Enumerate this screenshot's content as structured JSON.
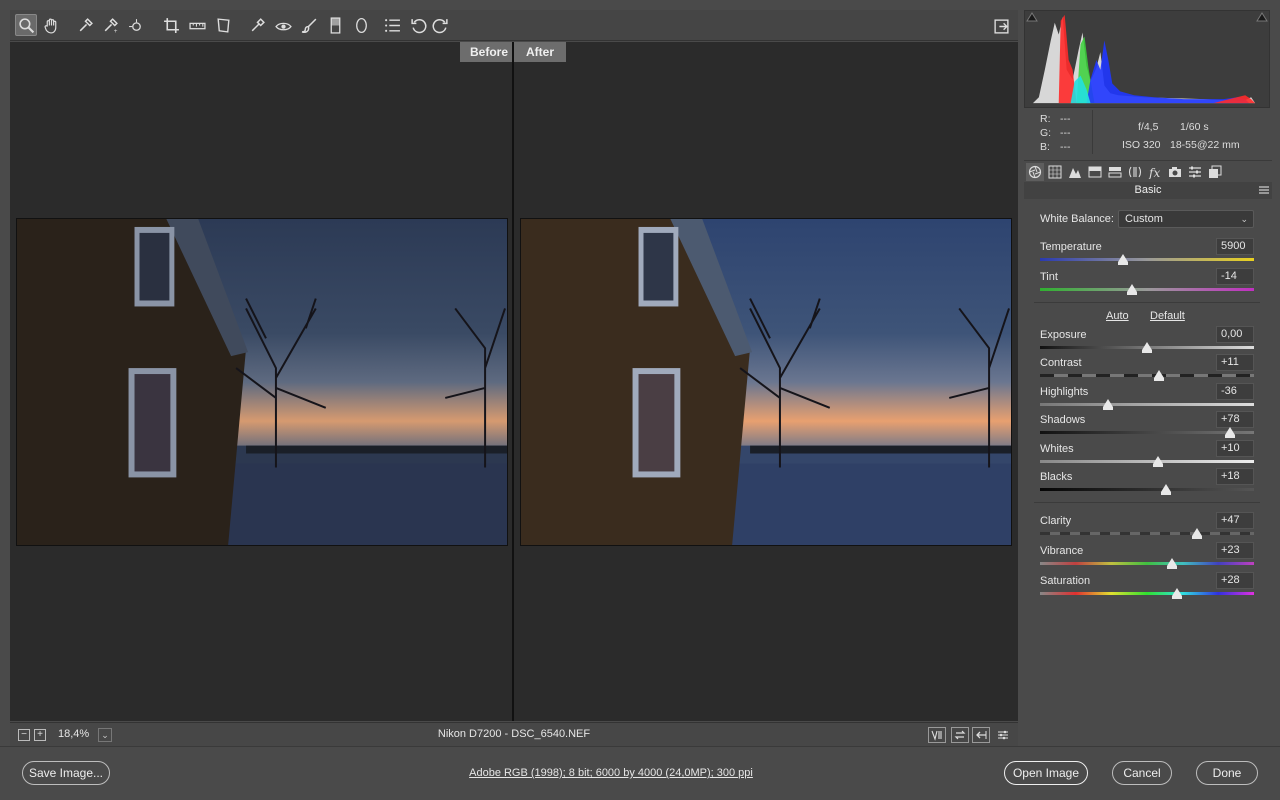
{
  "preview": {
    "before_label": "Before",
    "after_label": "After"
  },
  "statusbar": {
    "zoom_out": "−",
    "zoom_in": "+",
    "zoom_value": "18,4%",
    "zoom_dropdown": "⌄",
    "file_label": "Nikon D7200  -  DSC_6540.NEF"
  },
  "readout": {
    "r_label": "R:",
    "r_value": "---",
    "g_label": "G:",
    "g_value": "---",
    "b_label": "B:",
    "b_value": "---"
  },
  "exif": {
    "aperture": "f/4,5",
    "shutter": "1/60 s",
    "iso": "ISO 320",
    "lens": "18-55@22 mm"
  },
  "panel": {
    "title": "Basic",
    "white_balance_label": "White Balance:",
    "white_balance_value": "Custom",
    "auto_label": "Auto",
    "default_label": "Default",
    "sliders": {
      "temperature": {
        "label": "Temperature",
        "value": "5900",
        "position": 0.39
      },
      "tint": {
        "label": "Tint",
        "value": "-14",
        "position": 0.43
      },
      "exposure": {
        "label": "Exposure",
        "value": "0,00",
        "position": 0.5
      },
      "contrast": {
        "label": "Contrast",
        "value": "+11",
        "position": 0.555
      },
      "highlights": {
        "label": "Highlights",
        "value": "-36",
        "position": 0.32
      },
      "shadows": {
        "label": "Shadows",
        "value": "+78",
        "position": 0.89
      },
      "whites": {
        "label": "Whites",
        "value": "+10",
        "position": 0.55
      },
      "blacks": {
        "label": "Blacks",
        "value": "+18",
        "position": 0.59
      },
      "clarity": {
        "label": "Clarity",
        "value": "+47",
        "position": 0.735
      },
      "vibrance": {
        "label": "Vibrance",
        "value": "+23",
        "position": 0.615
      },
      "saturation": {
        "label": "Saturation",
        "value": "+28",
        "position": 0.64
      }
    }
  },
  "footer": {
    "save_label": "Save Image...",
    "workflow_label": "Adobe RGB (1998); 8 bit; 6000 by 4000 (24,0MP); 300 ppi",
    "open_label": "Open Image",
    "cancel_label": "Cancel",
    "done_label": "Done"
  },
  "icons": {
    "toolbar": [
      "zoom-icon",
      "hand-icon",
      "white-balance-icon",
      "color-sampler-icon",
      "targeted-adjustment-icon",
      "crop-icon",
      "straighten-icon",
      "transform-icon",
      "spot-removal-icon",
      "red-eye-icon",
      "adjustment-brush-icon",
      "graduated-filter-icon",
      "radial-filter-icon",
      "preferences-icon",
      "rotate-left-icon",
      "rotate-right-icon"
    ]
  },
  "colors": {
    "accent": "#e8e8e8",
    "panel_bg": "#4a4a4a",
    "preview_bg": "#2b2b2b"
  }
}
